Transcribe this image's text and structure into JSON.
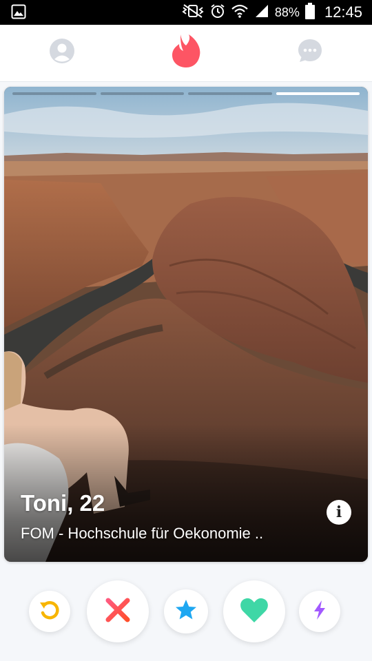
{
  "status_bar": {
    "battery": "88%",
    "time": "12:45"
  },
  "top_nav": {
    "items": [
      "profile-icon",
      "tinder-flame-icon",
      "messages-icon"
    ],
    "active": "tinder-flame-icon",
    "accent_color": "#fd5564"
  },
  "card": {
    "photo_count": 4,
    "active_photo": 4,
    "name": "Toni, 22",
    "school": "FOM - Hochschule für Oekonomie .."
  },
  "actions": {
    "buttons": [
      "rewind-icon",
      "nope-icon",
      "super-like-icon",
      "like-icon",
      "boost-icon"
    ],
    "colors": {
      "rewind": "#f7b500",
      "nope": "#ff4458",
      "super_like": "#1ea7f1",
      "like": "#3fd7a6",
      "boost": "#a259ff"
    }
  }
}
